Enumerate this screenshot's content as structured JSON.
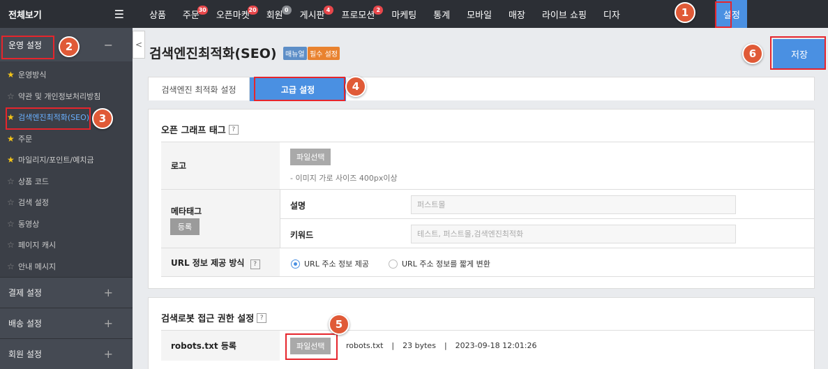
{
  "sidebar": {
    "title": "전체보기",
    "section_active": {
      "label": "운영 설정",
      "toggle": "−"
    },
    "items": [
      {
        "label": "운영방식",
        "starred": true
      },
      {
        "label": "약관 및 개인정보처리방침",
        "starred": false
      },
      {
        "label": "검색엔진최적화(SEO)",
        "starred": true,
        "active": true
      },
      {
        "label": "주문",
        "starred": true
      },
      {
        "label": "마일리지/포인트/예치금",
        "starred": true
      },
      {
        "label": "상품 코드",
        "starred": false
      },
      {
        "label": "검색 설정",
        "starred": false
      },
      {
        "label": "동영상",
        "starred": false
      },
      {
        "label": "페이지 캐시",
        "starred": false
      },
      {
        "label": "안내 메시지",
        "starred": false
      }
    ],
    "collapsed_sections": [
      {
        "label": "결제 설정",
        "toggle": "+"
      },
      {
        "label": "배송 설정",
        "toggle": "+"
      },
      {
        "label": "회원 설정",
        "toggle": "+"
      }
    ]
  },
  "topnav": {
    "items": [
      {
        "label": "상품",
        "badge": ""
      },
      {
        "label": "주문",
        "badge": "30"
      },
      {
        "label": "오픈마켓",
        "badge": "20"
      },
      {
        "label": "회원",
        "badge": "0"
      },
      {
        "label": "게시판",
        "badge": "4"
      },
      {
        "label": "프로모션",
        "badge": "2"
      },
      {
        "label": "마케팅",
        "badge": ""
      },
      {
        "label": "통계",
        "badge": ""
      },
      {
        "label": "모바일",
        "badge": ""
      },
      {
        "label": "매장",
        "badge": ""
      },
      {
        "label": "라이브 쇼핑",
        "badge": ""
      },
      {
        "label": "디자",
        "badge": ""
      }
    ],
    "active": "설정"
  },
  "header": {
    "title": "검색엔진최적화(SEO)",
    "tag_manual": "매뉴얼",
    "tag_required": "필수 설정",
    "save_label": "저장",
    "collapse_glyph": "<"
  },
  "tabs": {
    "basic": "검색엔진 최적화 설정",
    "advanced": "고급 설정"
  },
  "og_section": {
    "title": "오픈 그래프 태그",
    "help": "?",
    "logo_label": "로고",
    "file_button": "파일선택",
    "logo_hint": "- 이미지 가로 사이즈 400px이상",
    "metatag_label": "메타태그",
    "register_button": "등록",
    "desc_label": "설명",
    "desc_placeholder": "퍼스트몰",
    "keyword_label": "키워드",
    "keyword_placeholder": "테스트, 퍼스트몰,검색엔진최적화",
    "url_label": "URL 정보 제공 방식",
    "url_option1": "URL 주소 정보 제공",
    "url_option2": "URL 주소 정보를 짧게 변환",
    "url_selected": 1
  },
  "robot_section": {
    "title": "검색로봇 접근 권한 설정",
    "help": "?",
    "robots_label": "robots.txt 등록",
    "file_button": "파일선택",
    "file_name": "robots.txt",
    "file_size": "23 bytes",
    "file_date": "2023-09-18 12:01:26",
    "separator": "|"
  },
  "annotations": [
    "1",
    "2",
    "3",
    "4",
    "5",
    "6"
  ],
  "colors": {
    "accent": "#4a90e2",
    "highlight": "#e6252c",
    "marker": "#e05a37"
  }
}
